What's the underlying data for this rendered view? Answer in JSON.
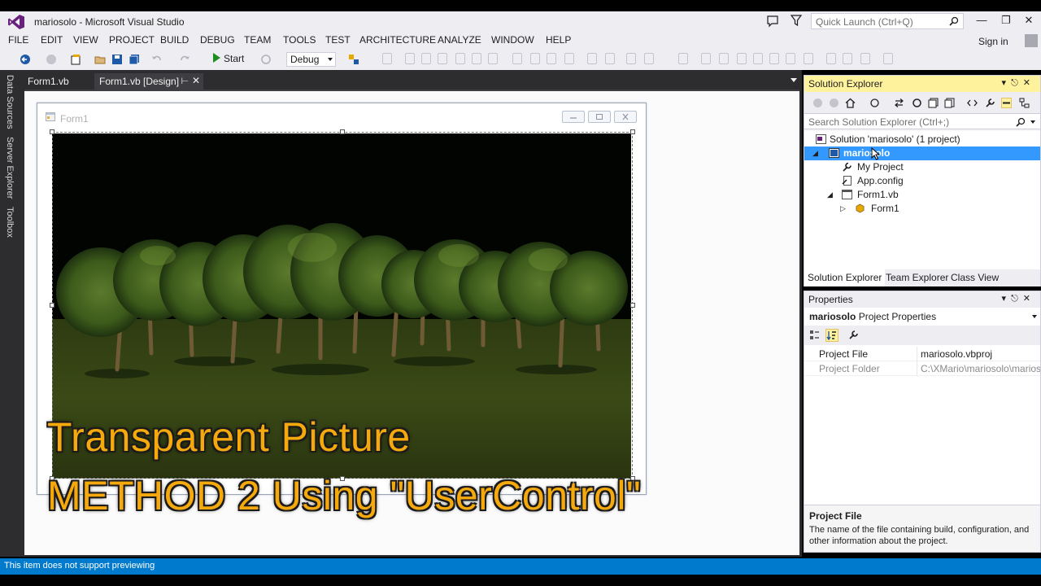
{
  "window": {
    "title": "mariosolo - Microsoft Visual Studio",
    "quick_launch_placeholder": "Quick Launch (Ctrl+Q)"
  },
  "menu": {
    "items": [
      "FILE",
      "EDIT",
      "VIEW",
      "PROJECT",
      "BUILD",
      "DEBUG",
      "TEAM",
      "TOOLS",
      "TEST",
      "ARCHITECTURE",
      "ANALYZE",
      "WINDOW",
      "HELP"
    ],
    "sign_in": "Sign in"
  },
  "toolbar": {
    "start_label": "Start",
    "configuration": "Debug"
  },
  "side_tabs": [
    "Data Sources",
    "Server Explorer",
    "Toolbox"
  ],
  "doc_tabs": {
    "tab1": "Form1.vb",
    "tab2": "Form1.vb [Design]"
  },
  "designer": {
    "form_title": "Form1"
  },
  "caption": {
    "line1": "Transparent Picture",
    "line2": "METHOD 2 Using \"UserControl\""
  },
  "solution_explorer": {
    "title": "Solution Explorer",
    "search_placeholder": "Search Solution Explorer (Ctrl+;)",
    "tree": {
      "solution": "Solution 'mariosolo' (1 project)",
      "project": "mariosolo",
      "my_project": "My Project",
      "app_config": "App.config",
      "form1_vb": "Form1.vb",
      "form1": "Form1"
    },
    "tabs": [
      "Solution Explorer",
      "Team Explorer",
      "Class View"
    ]
  },
  "properties": {
    "title": "Properties",
    "object_name": "mariosolo",
    "object_type": "Project Properties",
    "rows": [
      {
        "name": "Project File",
        "value": "mariosolo.vbproj"
      },
      {
        "name": "Project Folder",
        "value": "C:\\XMario\\mariosolo\\marios"
      }
    ],
    "desc_title": "Project File",
    "desc_text": "The name of the file containing build, configuration, and other information about the project."
  },
  "status": {
    "text": "This item does not support previewing"
  },
  "colors": {
    "accent": "#007acc",
    "selection": "#3399ff",
    "active_panel_header": "#fff29d",
    "caption": "#f6a90c"
  }
}
